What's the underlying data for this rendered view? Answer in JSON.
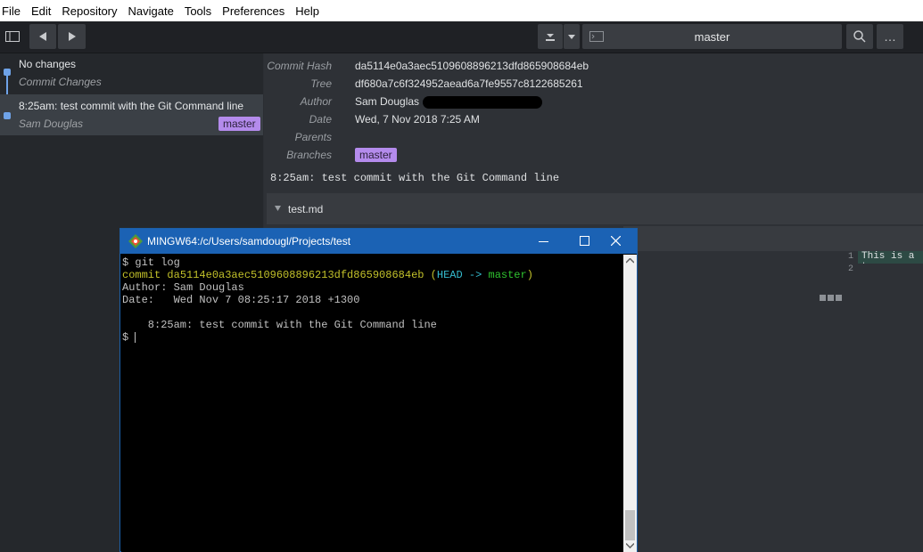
{
  "menu": [
    "File",
    "Edit",
    "Repository",
    "Navigate",
    "Tools",
    "Preferences",
    "Help"
  ],
  "toolbar": {
    "branch": "master",
    "more": "…"
  },
  "sidebar": {
    "uncommitted_title": "No changes",
    "uncommitted_sub": "Commit Changes",
    "commit_title": "8:25am: test commit with the Git Command line",
    "commit_author": "Sam Douglas",
    "commit_branch": "master"
  },
  "details": {
    "labels": {
      "hash": "Commit Hash",
      "tree": "Tree",
      "author": "Author",
      "date": "Date",
      "parents": "Parents",
      "branches": "Branches"
    },
    "hash": "da5114e0a3aec5109608896213dfd865908684eb",
    "tree": "df680a7c6f324952aead6a7fe9557c8122685261",
    "author": "Sam Douglas",
    "date": "Wed, 7 Nov 2018 7:25 AM",
    "branch": "master",
    "message": "8:25am: test commit with the Git Command line",
    "file": "test.md",
    "line_numbers": [
      "1",
      "2"
    ],
    "line1": "This is a te"
  },
  "terminal": {
    "title": "MINGW64:/c/Users/samdougl/Projects/test",
    "cmd": "$ git log",
    "commit_word": "commit",
    "commit_hash": "da5114e0a3aec5109608896213dfd865908684eb",
    "head_open": "(",
    "head": "HEAD ->",
    "head_branch": "master",
    "head_close": ")",
    "author_line": "Author: Sam Douglas",
    "date_line": "Date:   Wed Nov 7 08:25:17 2018 +1300",
    "message_line": "    8:25am: test commit with the Git Command line",
    "prompt": "$"
  },
  "colors": {
    "accent": "#6fa3e8",
    "tag": "#b48bec",
    "term_yellow": "#c2c12a",
    "term_cyan": "#35bccf",
    "term_green": "#2fc22f",
    "term_title": "#1b62b4"
  }
}
